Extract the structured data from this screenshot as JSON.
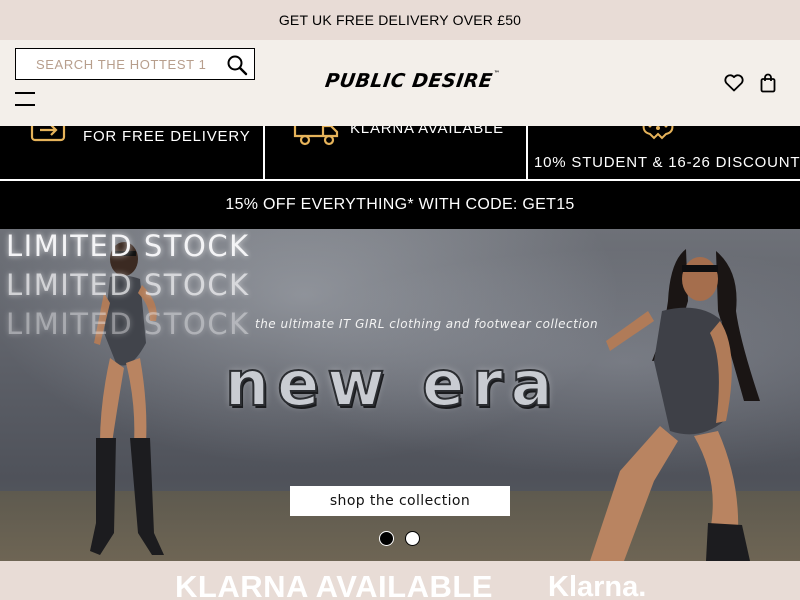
{
  "announcement": {
    "text": "GET UK FREE DELIVERY OVER £50"
  },
  "header": {
    "search_placeholder": "SEARCH THE HOTTEST 1",
    "logo_text": "PUBLIC DESIRE",
    "icons": [
      "search-icon",
      "menu-icon",
      "heart-icon",
      "bag-icon"
    ]
  },
  "usps": [
    {
      "label": "FOR FREE DELIVERY",
      "icon": "delivery-return-icon"
    },
    {
      "label": "KLARNA AVAILABLE",
      "icon": "truck-icon"
    },
    {
      "label": "10% STUDENT & 16-26 DISCOUNT",
      "icon": "gift-icon"
    }
  ],
  "promo": {
    "text": "15% OFF EVERYTHING* WITH CODE: GET15"
  },
  "hero": {
    "stock_lines": [
      "LIMITED STOCK",
      "LIMITED STOCK",
      "LIMITED STOCK"
    ],
    "tagline": "the ultimate IT GIRL clothing and footwear collection",
    "headline": "new era",
    "cta_label": "shop the collection",
    "slides_total": 2,
    "active_slide": 1
  },
  "klarna_banner": {
    "text": "KLARNA AVAILABLE",
    "brand": "Klarna."
  },
  "colors": {
    "nude": "#e8dcd6",
    "cream": "#f3efea",
    "accent": "#e6b35a",
    "black": "#000000"
  }
}
